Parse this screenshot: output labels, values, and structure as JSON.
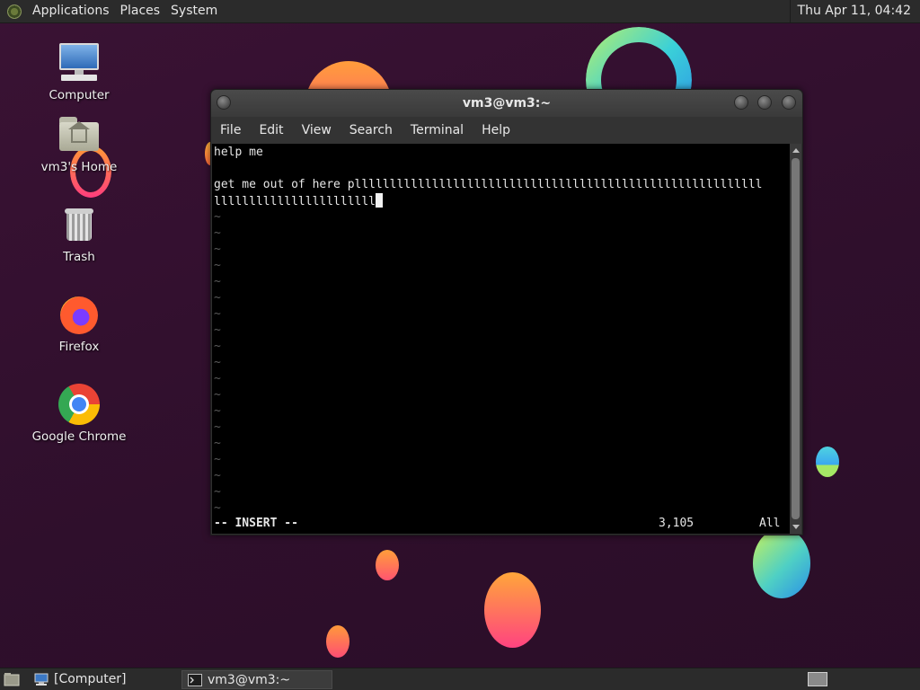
{
  "top_panel": {
    "menus": [
      "Applications",
      "Places",
      "System"
    ],
    "clock": "Thu Apr 11, 04:42"
  },
  "desktop": {
    "icons": [
      {
        "label": "Computer",
        "icon": "computer-icon"
      },
      {
        "label": "vm3's Home",
        "icon": "home-folder-icon"
      },
      {
        "label": "Trash",
        "icon": "trash-icon"
      },
      {
        "label": "Firefox",
        "icon": "firefox-icon"
      },
      {
        "label": "Google Chrome",
        "icon": "chrome-icon"
      }
    ]
  },
  "terminal": {
    "title": "vm3@vm3:~",
    "menu": [
      "File",
      "Edit",
      "View",
      "Search",
      "Terminal",
      "Help"
    ],
    "lines": [
      "help me",
      "",
      "get me out of here pllllllllllllllllllllllllllllllllllllllllllllllllllllllllll",
      "lllllllllllllllllllllll"
    ],
    "tilde": "~",
    "tilde_count": 19,
    "status_mode": "-- INSERT --",
    "status_pos": "3,105",
    "status_scroll": "All"
  },
  "bottom_panel": {
    "tasks": [
      "[Computer]",
      "vm3@vm3:~"
    ]
  },
  "colors": {
    "panel": "#2b2b2b",
    "wallpaper": "#3a1234",
    "terminal_bg": "#000000"
  }
}
